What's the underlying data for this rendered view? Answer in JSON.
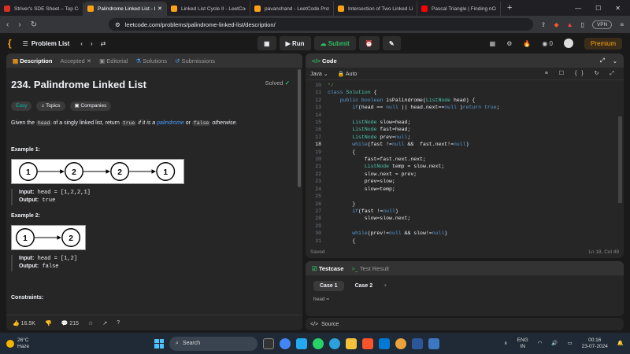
{
  "browser": {
    "tabs": [
      {
        "title": "Striver's SDE Sheet – Top Codin",
        "color": "#d93025"
      },
      {
        "title": "Palindrome Linked List - Le",
        "color": "#ffa116",
        "active": true
      },
      {
        "title": "Linked List Cycle II - LeetCode",
        "color": "#ffa116"
      },
      {
        "title": "pavanchand - LeetCode Profile",
        "color": "#ffa116"
      },
      {
        "title": "Intersection of Two Linked Lists",
        "color": "#ffa116"
      },
      {
        "title": "Pascal Triangle | Finding nCr in",
        "color": "#ff0000"
      }
    ],
    "url": "leetcode.com/problems/palindrome-linked-list/description/",
    "vpn_label": "VPN"
  },
  "header": {
    "problem_list": "Problem List",
    "run": "Run",
    "submit": "Submit",
    "coins": "0",
    "premium": "Premium"
  },
  "left_panel": {
    "tabs": [
      "Description",
      "Accepted",
      "Editorial",
      "Solutions",
      "Submissions"
    ],
    "title": "234. Palindrome Linked List",
    "solved": "Solved",
    "chips": [
      "Easy",
      "Topics",
      "Companies"
    ],
    "statement": {
      "p1": "Given the ",
      "code1": "head",
      "p2": " of a singly linked list, return ",
      "code2": "true",
      "p3": " if it is a ",
      "link": "palindrome",
      "p4": " or ",
      "code3": "false",
      "p5": " otherwise."
    },
    "example1": {
      "label": "Example 1:",
      "nodes": [
        "1",
        "2",
        "2",
        "1"
      ],
      "input_label": "Input:",
      "input": "head = [1,2,2,1]",
      "output_label": "Output:",
      "output": "true"
    },
    "example2": {
      "label": "Example 2:",
      "nodes": [
        "1",
        "2"
      ],
      "input_label": "Input:",
      "input": "head = [1,2]",
      "output_label": "Output:",
      "output": "false"
    },
    "constraints": "Constraints:",
    "footer": {
      "likes": "16.5K",
      "comments": "215"
    }
  },
  "code_panel": {
    "title": "Code",
    "language": "Java",
    "mode": "Auto",
    "lines": [
      {
        "n": "10",
        "t": "*/",
        "c": "cm"
      },
      {
        "n": "11",
        "t": "class Solution {"
      },
      {
        "n": "12",
        "t": "    public boolean isPalindrome(ListNode head) {"
      },
      {
        "n": "13",
        "t": "        if(head == null || head.next==null )return true;"
      },
      {
        "n": "14",
        "t": ""
      },
      {
        "n": "15",
        "t": "        ListNode slow=head;"
      },
      {
        "n": "16",
        "t": "        ListNode fast=head;"
      },
      {
        "n": "17",
        "t": "        ListNode prev=null;"
      },
      {
        "n": "18",
        "t": "        while(fast !=null &&  fast.next!=null)"
      },
      {
        "n": "19",
        "t": "        {"
      },
      {
        "n": "20",
        "t": "            fast=fast.next.next;"
      },
      {
        "n": "21",
        "t": "            ListNode temp = slow.next;"
      },
      {
        "n": "22",
        "t": "            slow.next = prev;"
      },
      {
        "n": "23",
        "t": "            prev=slow;"
      },
      {
        "n": "24",
        "t": "            slow=temp;"
      },
      {
        "n": "25",
        "t": ""
      },
      {
        "n": "26",
        "t": "        }"
      },
      {
        "n": "27",
        "t": "        if(fast !=null)"
      },
      {
        "n": "28",
        "t": "            slow=slow.next;"
      },
      {
        "n": "29",
        "t": ""
      },
      {
        "n": "30",
        "t": "        while(prev!=null && slow!=null)"
      },
      {
        "n": "31",
        "t": "        {"
      }
    ],
    "current_line": "18",
    "status": "Saved",
    "cursor": "Ln 18, Col 49"
  },
  "testcase_panel": {
    "tab_testcase": "Testcase",
    "tab_result": "Test Result",
    "cases": [
      "Case 1",
      "Case 2"
    ],
    "add": "+",
    "field_label": "head ="
  },
  "source_label": "Source",
  "taskbar": {
    "temp": "26°C",
    "weather": "Haze",
    "search": "Search",
    "lang": "ENG",
    "lang2": "IN",
    "time": "00:16",
    "date": "23-07-2024"
  }
}
